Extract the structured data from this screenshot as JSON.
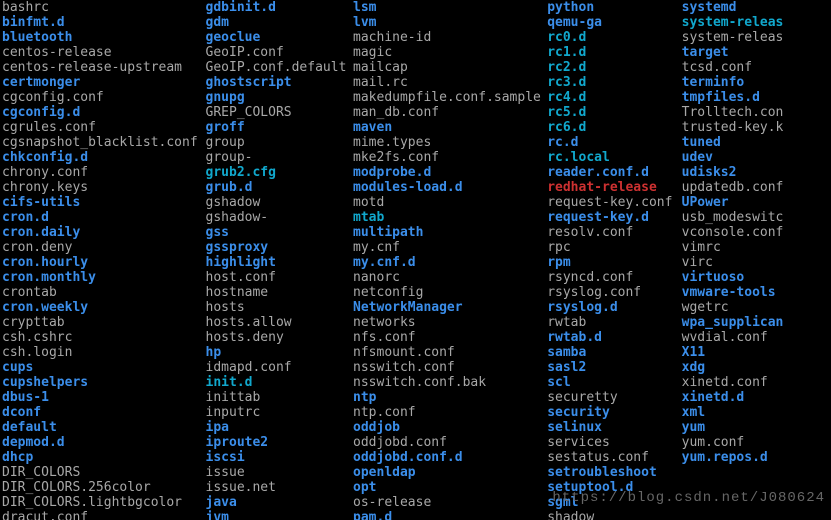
{
  "watermark": "https://blog.csdn.net/J080624",
  "columns": [
    [
      {
        "name": "bashrc",
        "type": "file"
      },
      {
        "name": "binfmt.d",
        "type": "dir"
      },
      {
        "name": "bluetooth",
        "type": "dir"
      },
      {
        "name": "centos-release",
        "type": "file"
      },
      {
        "name": "centos-release-upstream",
        "type": "file"
      },
      {
        "name": "certmonger",
        "type": "dir"
      },
      {
        "name": "cgconfig.conf",
        "type": "file"
      },
      {
        "name": "cgconfig.d",
        "type": "dir"
      },
      {
        "name": "cgrules.conf",
        "type": "file"
      },
      {
        "name": "cgsnapshot_blacklist.conf",
        "type": "file"
      },
      {
        "name": "chkconfig.d",
        "type": "dir"
      },
      {
        "name": "chrony.conf",
        "type": "file"
      },
      {
        "name": "chrony.keys",
        "type": "file"
      },
      {
        "name": "cifs-utils",
        "type": "dir"
      },
      {
        "name": "cron.d",
        "type": "dir"
      },
      {
        "name": "cron.daily",
        "type": "dir"
      },
      {
        "name": "cron.deny",
        "type": "file"
      },
      {
        "name": "cron.hourly",
        "type": "dir"
      },
      {
        "name": "cron.monthly",
        "type": "dir"
      },
      {
        "name": "crontab",
        "type": "file"
      },
      {
        "name": "cron.weekly",
        "type": "dir"
      },
      {
        "name": "crypttab",
        "type": "file"
      },
      {
        "name": "csh.cshrc",
        "type": "file"
      },
      {
        "name": "csh.login",
        "type": "file"
      },
      {
        "name": "cups",
        "type": "dir"
      },
      {
        "name": "cupshelpers",
        "type": "dir"
      },
      {
        "name": "dbus-1",
        "type": "dir"
      },
      {
        "name": "dconf",
        "type": "dir"
      },
      {
        "name": "default",
        "type": "dir"
      },
      {
        "name": "depmod.d",
        "type": "dir"
      },
      {
        "name": "dhcp",
        "type": "dir"
      },
      {
        "name": "DIR_COLORS",
        "type": "file"
      },
      {
        "name": "DIR_COLORS.256color",
        "type": "file"
      },
      {
        "name": "DIR_COLORS.lightbgcolor",
        "type": "file"
      },
      {
        "name": "dracut.conf",
        "type": "file"
      }
    ],
    [
      {
        "name": "gdbinit.d",
        "type": "dir"
      },
      {
        "name": "gdm",
        "type": "dir"
      },
      {
        "name": "geoclue",
        "type": "dir"
      },
      {
        "name": "GeoIP.conf",
        "type": "file"
      },
      {
        "name": "GeoIP.conf.default",
        "type": "file"
      },
      {
        "name": "ghostscript",
        "type": "dir"
      },
      {
        "name": "gnupg",
        "type": "dir"
      },
      {
        "name": "GREP_COLORS",
        "type": "file"
      },
      {
        "name": "groff",
        "type": "dir"
      },
      {
        "name": "group",
        "type": "file"
      },
      {
        "name": "group-",
        "type": "file"
      },
      {
        "name": "grub2.cfg",
        "type": "link"
      },
      {
        "name": "grub.d",
        "type": "dir"
      },
      {
        "name": "gshadow",
        "type": "file"
      },
      {
        "name": "gshadow-",
        "type": "file"
      },
      {
        "name": "gss",
        "type": "dir"
      },
      {
        "name": "gssproxy",
        "type": "dir"
      },
      {
        "name": "highlight",
        "type": "dir"
      },
      {
        "name": "host.conf",
        "type": "file"
      },
      {
        "name": "hostname",
        "type": "file"
      },
      {
        "name": "hosts",
        "type": "file"
      },
      {
        "name": "hosts.allow",
        "type": "file"
      },
      {
        "name": "hosts.deny",
        "type": "file"
      },
      {
        "name": "hp",
        "type": "dir"
      },
      {
        "name": "idmapd.conf",
        "type": "file"
      },
      {
        "name": "init.d",
        "type": "link"
      },
      {
        "name": "inittab",
        "type": "file"
      },
      {
        "name": "inputrc",
        "type": "file"
      },
      {
        "name": "ipa",
        "type": "dir"
      },
      {
        "name": "iproute2",
        "type": "dir"
      },
      {
        "name": "iscsi",
        "type": "dir"
      },
      {
        "name": "issue",
        "type": "file"
      },
      {
        "name": "issue.net",
        "type": "file"
      },
      {
        "name": "java",
        "type": "dir"
      },
      {
        "name": "jvm",
        "type": "dir"
      }
    ],
    [
      {
        "name": "lsm",
        "type": "dir"
      },
      {
        "name": "lvm",
        "type": "dir"
      },
      {
        "name": "machine-id",
        "type": "file"
      },
      {
        "name": "magic",
        "type": "file"
      },
      {
        "name": "mailcap",
        "type": "file"
      },
      {
        "name": "mail.rc",
        "type": "file"
      },
      {
        "name": "makedumpfile.conf.sample",
        "type": "file"
      },
      {
        "name": "man_db.conf",
        "type": "file"
      },
      {
        "name": "maven",
        "type": "dir"
      },
      {
        "name": "mime.types",
        "type": "file"
      },
      {
        "name": "mke2fs.conf",
        "type": "file"
      },
      {
        "name": "modprobe.d",
        "type": "dir"
      },
      {
        "name": "modules-load.d",
        "type": "dir"
      },
      {
        "name": "motd",
        "type": "file"
      },
      {
        "name": "mtab",
        "type": "link"
      },
      {
        "name": "multipath",
        "type": "dir"
      },
      {
        "name": "my.cnf",
        "type": "file"
      },
      {
        "name": "my.cnf.d",
        "type": "dir"
      },
      {
        "name": "nanorc",
        "type": "file"
      },
      {
        "name": "netconfig",
        "type": "file"
      },
      {
        "name": "NetworkManager",
        "type": "dir"
      },
      {
        "name": "networks",
        "type": "file"
      },
      {
        "name": "nfs.conf",
        "type": "file"
      },
      {
        "name": "nfsmount.conf",
        "type": "file"
      },
      {
        "name": "nsswitch.conf",
        "type": "file"
      },
      {
        "name": "nsswitch.conf.bak",
        "type": "file"
      },
      {
        "name": "ntp",
        "type": "dir"
      },
      {
        "name": "ntp.conf",
        "type": "file"
      },
      {
        "name": "oddjob",
        "type": "dir"
      },
      {
        "name": "oddjobd.conf",
        "type": "file"
      },
      {
        "name": "oddjobd.conf.d",
        "type": "dir"
      },
      {
        "name": "openldap",
        "type": "dir"
      },
      {
        "name": "opt",
        "type": "dir"
      },
      {
        "name": "os-release",
        "type": "file"
      },
      {
        "name": "pam.d",
        "type": "dir"
      }
    ],
    [
      {
        "name": "python",
        "type": "dir"
      },
      {
        "name": "qemu-ga",
        "type": "dir"
      },
      {
        "name": "rc0.d",
        "type": "link"
      },
      {
        "name": "rc1.d",
        "type": "link"
      },
      {
        "name": "rc2.d",
        "type": "link"
      },
      {
        "name": "rc3.d",
        "type": "link"
      },
      {
        "name": "rc4.d",
        "type": "link"
      },
      {
        "name": "rc5.d",
        "type": "link"
      },
      {
        "name": "rc6.d",
        "type": "link"
      },
      {
        "name": "rc.d",
        "type": "dir"
      },
      {
        "name": "rc.local",
        "type": "link"
      },
      {
        "name": "reader.conf.d",
        "type": "dir"
      },
      {
        "name": "redhat-release",
        "type": "red"
      },
      {
        "name": "request-key.conf",
        "type": "file"
      },
      {
        "name": "request-key.d",
        "type": "dir"
      },
      {
        "name": "resolv.conf",
        "type": "file"
      },
      {
        "name": "rpc",
        "type": "file"
      },
      {
        "name": "rpm",
        "type": "dir"
      },
      {
        "name": "rsyncd.conf",
        "type": "file"
      },
      {
        "name": "rsyslog.conf",
        "type": "file"
      },
      {
        "name": "rsyslog.d",
        "type": "dir"
      },
      {
        "name": "rwtab",
        "type": "file"
      },
      {
        "name": "rwtab.d",
        "type": "dir"
      },
      {
        "name": "samba",
        "type": "dir"
      },
      {
        "name": "sasl2",
        "type": "dir"
      },
      {
        "name": "scl",
        "type": "dir"
      },
      {
        "name": "securetty",
        "type": "file"
      },
      {
        "name": "security",
        "type": "dir"
      },
      {
        "name": "selinux",
        "type": "dir"
      },
      {
        "name": "services",
        "type": "file"
      },
      {
        "name": "sestatus.conf",
        "type": "file"
      },
      {
        "name": "setroubleshoot",
        "type": "dir"
      },
      {
        "name": "setuptool.d",
        "type": "dir"
      },
      {
        "name": "sgml",
        "type": "dir"
      },
      {
        "name": "shadow",
        "type": "file"
      }
    ],
    [
      {
        "name": "systemd",
        "type": "dir"
      },
      {
        "name": "system-releas",
        "type": "link"
      },
      {
        "name": "system-releas",
        "type": "file"
      },
      {
        "name": "target",
        "type": "dir"
      },
      {
        "name": "tcsd.conf",
        "type": "file"
      },
      {
        "name": "terminfo",
        "type": "dir"
      },
      {
        "name": "tmpfiles.d",
        "type": "dir"
      },
      {
        "name": "Trolltech.con",
        "type": "file"
      },
      {
        "name": "trusted-key.k",
        "type": "file"
      },
      {
        "name": "tuned",
        "type": "dir"
      },
      {
        "name": "udev",
        "type": "dir"
      },
      {
        "name": "udisks2",
        "type": "dir"
      },
      {
        "name": "updatedb.conf",
        "type": "file"
      },
      {
        "name": "UPower",
        "type": "dir"
      },
      {
        "name": "usb_modeswitc",
        "type": "file"
      },
      {
        "name": "vconsole.conf",
        "type": "file"
      },
      {
        "name": "vimrc",
        "type": "file"
      },
      {
        "name": "virc",
        "type": "file"
      },
      {
        "name": "virtuoso",
        "type": "dir"
      },
      {
        "name": "vmware-tools",
        "type": "dir"
      },
      {
        "name": "wgetrc",
        "type": "file"
      },
      {
        "name": "wpa_supplican",
        "type": "dir"
      },
      {
        "name": "wvdial.conf",
        "type": "file"
      },
      {
        "name": "X11",
        "type": "dir"
      },
      {
        "name": "xdg",
        "type": "dir"
      },
      {
        "name": "xinetd.conf",
        "type": "file"
      },
      {
        "name": "xinetd.d",
        "type": "dir"
      },
      {
        "name": "xml",
        "type": "dir"
      },
      {
        "name": "yum",
        "type": "dir"
      },
      {
        "name": "yum.conf",
        "type": "file"
      },
      {
        "name": "yum.repos.d",
        "type": "dir"
      }
    ]
  ]
}
